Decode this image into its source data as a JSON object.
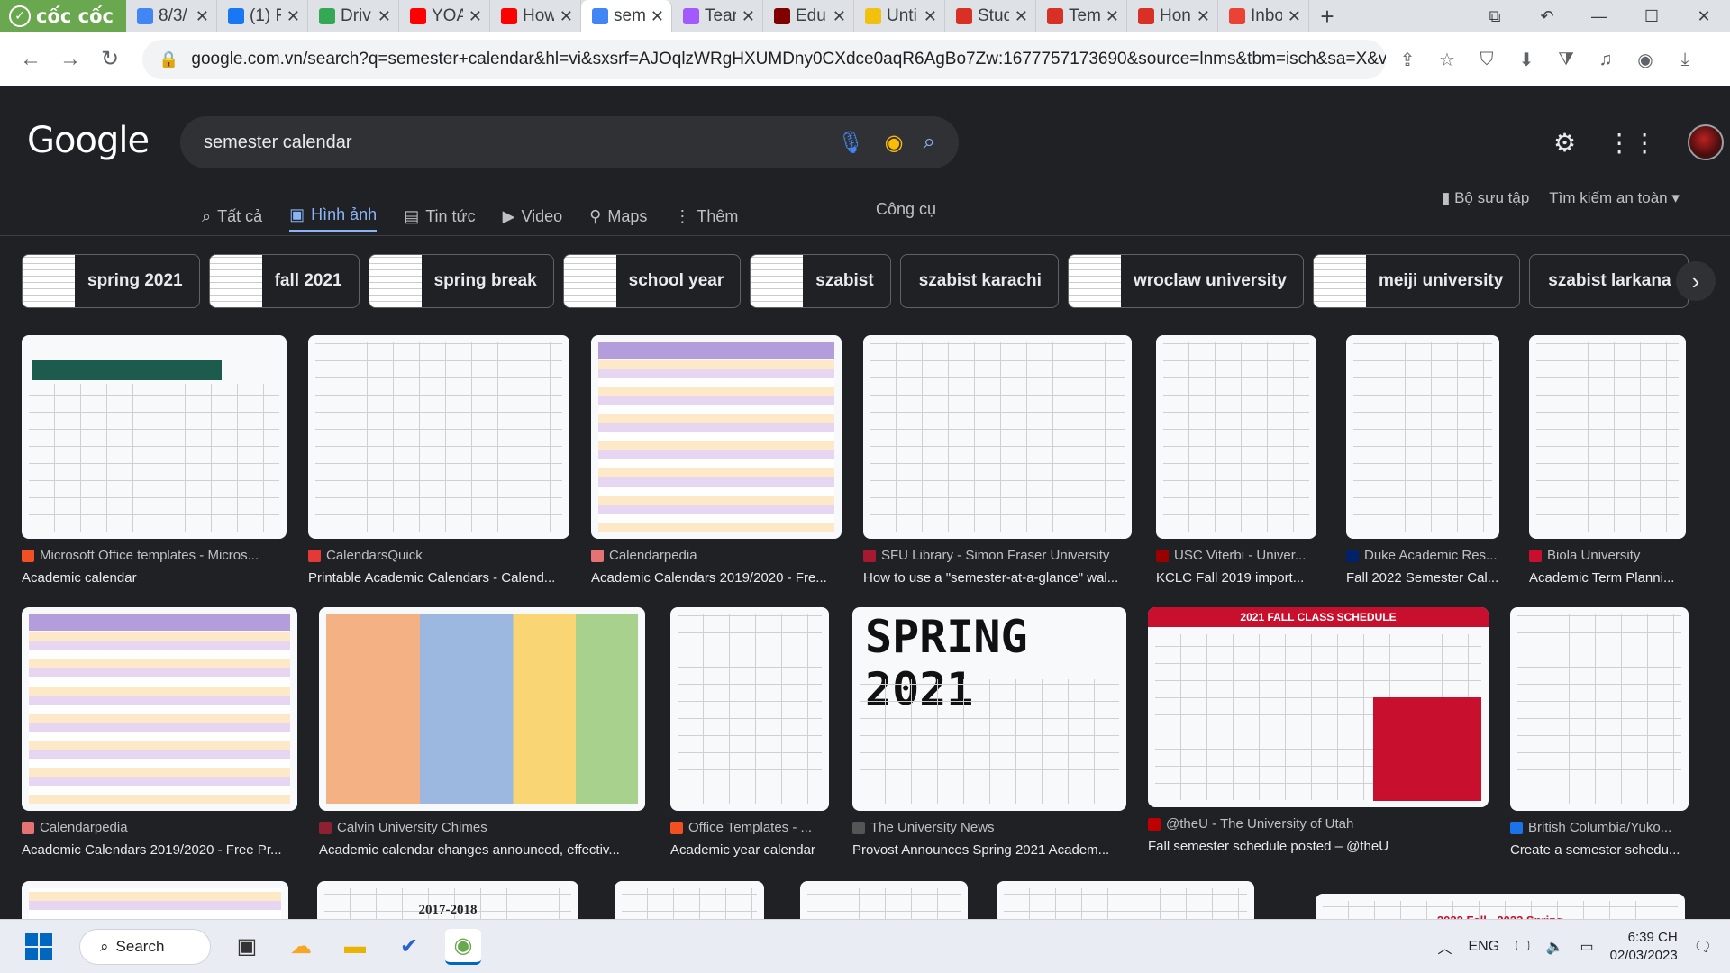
{
  "browser": {
    "brand": "cốc cốc",
    "tabs": [
      {
        "title": "8/3/",
        "icon": "docs-icon",
        "color": "#4285f4"
      },
      {
        "title": "(1) F",
        "icon": "facebook-icon",
        "color": "#1877f2"
      },
      {
        "title": "Driv",
        "icon": "drive-icon",
        "color": "#34a853"
      },
      {
        "title": "YOA",
        "icon": "youtube-icon",
        "color": "#ff0000"
      },
      {
        "title": "How",
        "icon": "youtube-icon",
        "color": "#ff0000"
      },
      {
        "title": "sem",
        "icon": "google-icon",
        "color": "#4285f4"
      },
      {
        "title": "Tear",
        "icon": "figma-icon",
        "color": "#a259ff"
      },
      {
        "title": "Edu",
        "icon": "miro-icon",
        "color": "#800000"
      },
      {
        "title": "Unti",
        "icon": "miro-icon",
        "color": "#f2c00f"
      },
      {
        "title": "Stud",
        "icon": "m-icon",
        "color": "#d93025"
      },
      {
        "title": "Tem",
        "icon": "m-icon",
        "color": "#d93025"
      },
      {
        "title": "Hon",
        "icon": "m-icon",
        "color": "#d93025"
      },
      {
        "title": "Inbo",
        "icon": "gmail-icon",
        "color": "#ea4335"
      }
    ],
    "url": "google.com.vn/search?q=semester+calendar&hl=vi&sxsrf=AJOqlzWRgHXUMDny0CXdce0aqR6AgBo7Zw:1677757173690&source=lnms&tbm=isch&sa=X&ved=2ahUKEw..."
  },
  "google": {
    "logo": "Google",
    "query": "semester calendar",
    "nav": [
      {
        "label": "Tất cả",
        "icon": "search-icon",
        "glyph": "⌕"
      },
      {
        "label": "Hình ảnh",
        "icon": "image-icon",
        "glyph": "▣"
      },
      {
        "label": "Tin tức",
        "icon": "news-icon",
        "glyph": "▤"
      },
      {
        "label": "Video",
        "icon": "video-icon",
        "glyph": "▶"
      },
      {
        "label": "Maps",
        "icon": "pin-icon",
        "glyph": "⚲"
      },
      {
        "label": "Thêm",
        "icon": "more-icon",
        "glyph": "⋮"
      }
    ],
    "tools": "Công cụ",
    "collections": "Bộ sưu tập",
    "safesearch": "Tìm kiếm an toàn"
  },
  "chips": [
    "spring 2021",
    "fall 2021",
    "spring break",
    "school year",
    "szabist",
    "szabist karachi",
    "wroclaw university",
    "meiji university",
    "szabist larkana"
  ],
  "results": [
    {
      "source": "Microsoft Office templates - Micros...",
      "caption": "Academic calendar",
      "color": "#f25022"
    },
    {
      "source": "CalendarsQuick",
      "caption": "Printable Academic Calendars - Calend...",
      "color": "#e53935"
    },
    {
      "source": "Calendarpedia",
      "caption": "Academic Calendars 2019/2020 - Fre...",
      "color": "#e57373"
    },
    {
      "source": "SFU Library - Simon Fraser University",
      "caption": "How to use a \"semester-at-a-glance\" wal...",
      "color": "#a6192e"
    },
    {
      "source": "USC Viterbi - Univer...",
      "caption": "KCLC Fall 2019 import...",
      "color": "#990000"
    },
    {
      "source": "Duke Academic Res...",
      "caption": "Fall 2022 Semester Cal...",
      "color": "#012169"
    },
    {
      "source": "Biola University",
      "caption": "Academic Term Planni...",
      "color": "#c8102e"
    },
    {
      "source": "Calendarpedia",
      "caption": "Academic Calendars 2019/2020 - Free Pr...",
      "color": "#e57373"
    },
    {
      "source": "Calvin University Chimes",
      "caption": "Academic calendar changes announced, effectiv...",
      "color": "#8c2131"
    },
    {
      "source": "Office Templates - ...",
      "caption": "Academic year calendar",
      "color": "#f25022"
    },
    {
      "source": "The University News",
      "caption": "Provost Announces Spring 2021 Academ...",
      "color": "#555555"
    },
    {
      "source": "@theU - The University of Utah",
      "caption": "Fall semester schedule posted – @theU",
      "color": "#be0000"
    },
    {
      "source": "British Columbia/Yuko...",
      "caption": "Create a semester schedu...",
      "color": "#1a73e8"
    }
  ],
  "image_text": {
    "spring": "SPRING 2021",
    "utah_banner": "2021 FALL CLASS SCHEDULE",
    "calvin_year": "2017-2018",
    "last_banner": "2022 Fall - 2023 Spring"
  },
  "taskbar": {
    "search": "Search",
    "lang": "ENG",
    "time": "6:39 CH",
    "date": "02/03/2023"
  }
}
